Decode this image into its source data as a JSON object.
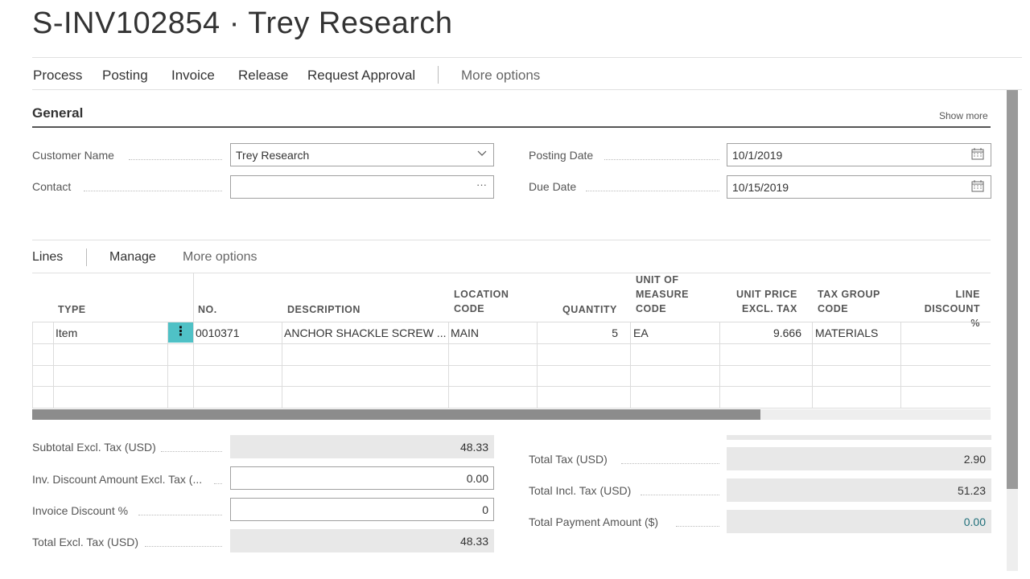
{
  "page": {
    "title": "S-INV102854 · Trey Research"
  },
  "action_bar": {
    "items": [
      "Process",
      "Posting",
      "Invoice",
      "Release",
      "Request Approval"
    ],
    "more": "More options"
  },
  "general": {
    "heading": "General",
    "show_more": "Show more",
    "customer_name": {
      "label": "Customer Name",
      "value": "Trey Research",
      "icon": "chevron-down-icon"
    },
    "contact": {
      "label": "Contact",
      "value": "",
      "icon": "ellipsis-icon"
    },
    "posting_date": {
      "label": "Posting Date",
      "value": "10/1/2019",
      "icon": "calendar-icon"
    },
    "due_date": {
      "label": "Due Date",
      "value": "10/15/2019",
      "icon": "calendar-icon"
    }
  },
  "lines": {
    "tabs": [
      "Lines",
      "Manage",
      "More options"
    ],
    "columns": {
      "type": "TYPE",
      "no": "NO.",
      "description": "DESCRIPTION",
      "location_code": [
        "LOCATION",
        "CODE"
      ],
      "quantity": "QUANTITY",
      "uom_code": [
        "UNIT OF",
        "MEASURE",
        "CODE"
      ],
      "unit_price": [
        "UNIT PRICE",
        "EXCL. TAX"
      ],
      "tax_group": [
        "TAX GROUP",
        "CODE"
      ],
      "line_discount": [
        "LINE",
        "DISCOUNT %"
      ]
    },
    "rows": [
      {
        "type": "Item",
        "menu_icon": "vertical-ellipsis-icon",
        "no": "0010371",
        "description": "ANCHOR SHACKLE SCREW ...",
        "location_code": "MAIN",
        "quantity": "5",
        "uom_code": "EA",
        "unit_price": "9.666",
        "tax_group": "MATERIALS",
        "line_discount": ""
      }
    ],
    "horizontal_scroll_fraction": 0.76
  },
  "totals": {
    "left": [
      {
        "label": "Subtotal Excl. Tax (USD)",
        "value": "48.33",
        "editable": false
      },
      {
        "label": "Inv. Discount Amount Excl. Tax (...",
        "value": "0.00",
        "editable": true
      },
      {
        "label": "Invoice Discount %",
        "value": "0",
        "editable": true
      },
      {
        "label": "Total Excl. Tax (USD)",
        "value": "48.33",
        "editable": false
      }
    ],
    "right": [
      {
        "label": "Total Tax (USD)",
        "value": "2.90"
      },
      {
        "label": "Total Incl. Tax (USD)",
        "value": "51.23"
      },
      {
        "label": "Total Payment Amount ($)",
        "value": "0.00"
      }
    ]
  },
  "colors": {
    "accent": "#4fc1c6",
    "link": "#1f6f7a",
    "readonly_bg": "#e8e8e8"
  }
}
